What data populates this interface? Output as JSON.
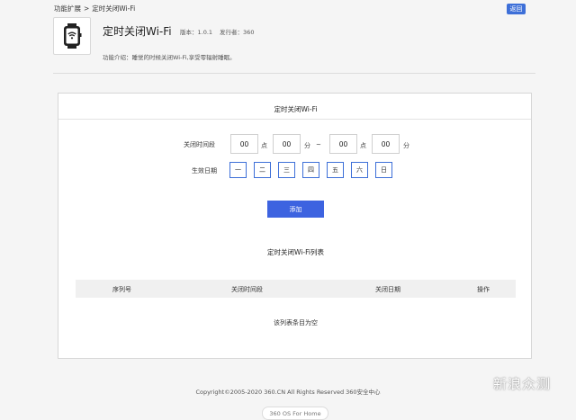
{
  "breadcrumb": {
    "parent": "功能扩展",
    "separator": ">",
    "current": "定时关闭Wi-Fi"
  },
  "back_button": "返回",
  "app": {
    "title": "定时关闭Wi-Fi",
    "version": "版本：1.0.1",
    "publisher": "发行者：360",
    "description": "功能介绍：睡觉的时候关闭Wi-Fi,享受零辐射睡眠。",
    "icon": "smartwatch-wifi-icon"
  },
  "card": {
    "title": "定时关闭Wi-Fi",
    "time_label": "关闭时间段",
    "start_hour": "00",
    "start_minute": "00",
    "end_hour": "00",
    "end_minute": "00",
    "unit_hour": "点",
    "unit_minute": "分",
    "range_separator": "~",
    "days_label": "生效日期",
    "days": [
      "一",
      "二",
      "三",
      "四",
      "五",
      "六",
      "日"
    ],
    "add_button": "添加",
    "list_title": "定时关闭Wi-Fi列表",
    "columns": [
      "序列号",
      "关闭时间段",
      "关闭日期",
      "操作"
    ],
    "empty_message": "该列表条目为空"
  },
  "footer": {
    "copyright": "Copyright©2005-2020 360.CN All Rights Reserved 360安全中心",
    "os_label": "360 OS For Home"
  },
  "watermark": "新浪众测",
  "colors": {
    "accent": "#3d63e0",
    "border": "#d6d6d6",
    "table_header_bg": "#f0f0f0"
  }
}
